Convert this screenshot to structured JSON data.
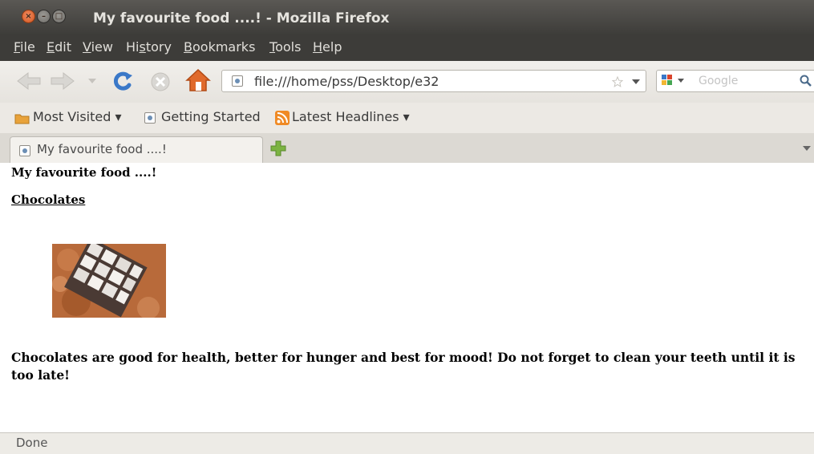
{
  "window": {
    "title": "My favourite food ....! - Mozilla Firefox",
    "close_glyph": "×",
    "min_glyph": "–",
    "max_glyph": "□"
  },
  "menu": {
    "items": [
      {
        "pre": "",
        "key": "F",
        "post": "ile"
      },
      {
        "pre": "",
        "key": "E",
        "post": "dit"
      },
      {
        "pre": "",
        "key": "V",
        "post": "iew"
      },
      {
        "pre": "Hi",
        "key": "s",
        "post": "tory"
      },
      {
        "pre": "",
        "key": "B",
        "post": "ookmarks"
      },
      {
        "pre": "",
        "key": "T",
        "post": "ools"
      },
      {
        "pre": "",
        "key": "H",
        "post": "elp"
      }
    ]
  },
  "toolbar": {
    "url": "file:///home/pss/Desktop/e32",
    "search_placeholder": "Google"
  },
  "bookmarks": {
    "most_visited": "Most Visited ▾",
    "getting_started": "Getting Started",
    "latest_headlines": "Latest Headlines ▾"
  },
  "tabs": {
    "active_label": "My favourite food ....!"
  },
  "page": {
    "title": "My favourite food ....!",
    "heading": "Chocolates",
    "paragraph": "Chocolates are good for health, better for hunger and best for mood! Do not forget to clean your teeth until it is too late!"
  },
  "status": {
    "text": "Done"
  },
  "colors": {
    "titlebar": "#3d3c39",
    "close_button": "#d2561f",
    "home_icon": "#e06a2c",
    "reload_icon": "#3a78c8",
    "rss_icon": "#f08a24",
    "new_tab_icon": "#7cb342"
  }
}
